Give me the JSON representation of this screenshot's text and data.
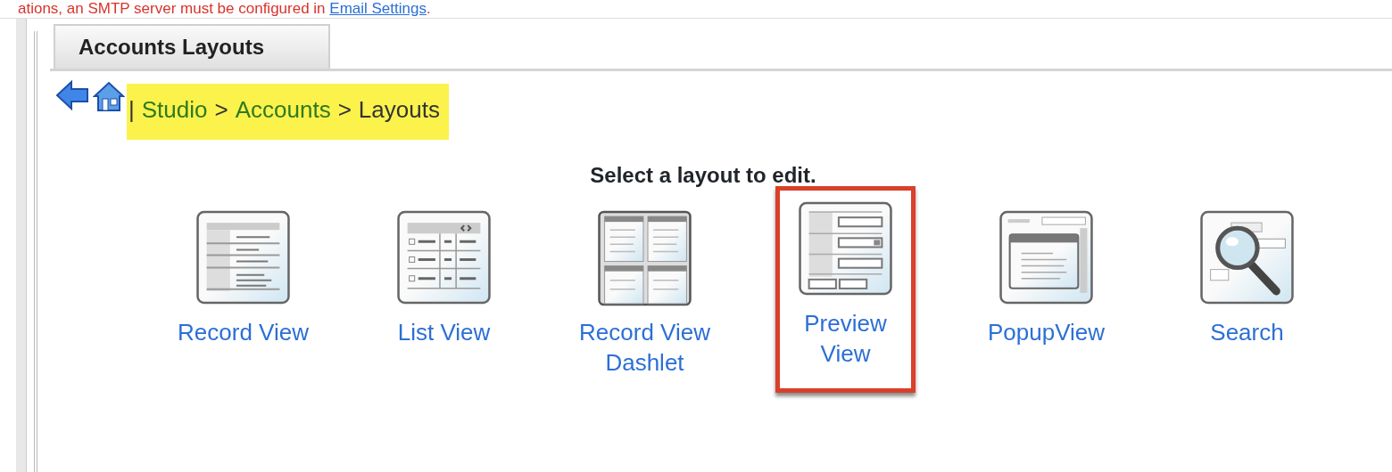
{
  "notice": {
    "text": "ations, an SMTP server must be configured in",
    "link": "Email Settings",
    "end": "."
  },
  "tabs": [
    {
      "label": "Accounts Layouts"
    }
  ],
  "breadcrumb": [
    {
      "label": "|",
      "kind": "separator"
    },
    {
      "label": "Studio",
      "kind": "link"
    },
    {
      "label": ">",
      "kind": "separator"
    },
    {
      "label": "Accounts",
      "kind": "link"
    },
    {
      "label": ">",
      "kind": "separator"
    },
    {
      "label": "Layouts",
      "kind": "current"
    }
  ],
  "heading": "Select a layout to edit.",
  "layouts": [
    {
      "label": "Record View",
      "kind": "record",
      "selected": false
    },
    {
      "label": "List View",
      "kind": "list",
      "selected": false
    },
    {
      "label": "Record View Dashlet",
      "kind": "dashlet",
      "selected": false
    },
    {
      "label": "Preview View",
      "kind": "preview",
      "selected": true
    },
    {
      "label": "PopupView",
      "kind": "popup",
      "selected": false
    },
    {
      "label": "Search",
      "kind": "search",
      "selected": false
    }
  ]
}
